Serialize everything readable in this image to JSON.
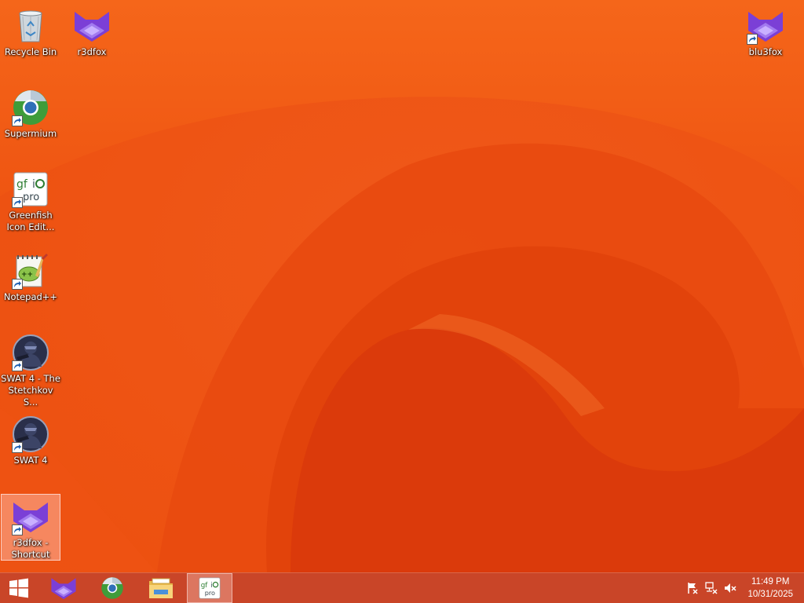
{
  "desktop": {
    "icons": [
      {
        "label": "Recycle Bin",
        "icon": "recycle-bin-icon"
      },
      {
        "label": "r3dfox",
        "icon": "r3dfox-icon"
      },
      {
        "label": "blu3fox",
        "icon": "blu3fox-icon"
      },
      {
        "label": "Supermium",
        "icon": "supermium-icon"
      },
      {
        "label": "Greenfish\nIcon Edit...",
        "icon": "greenfish-icon-editor-icon"
      },
      {
        "label": "Notepad++",
        "icon": "notepad-plus-plus-icon"
      },
      {
        "label": "SWAT 4 - The\nStetchkov S...",
        "icon": "swat4-stetchkov-icon"
      },
      {
        "label": "SWAT 4",
        "icon": "swat4-icon"
      },
      {
        "label": "r3dfox -\nShortcut",
        "icon": "r3dfox-shortcut-icon"
      }
    ]
  },
  "taskbar": {
    "start_icon": "windows-start-icon",
    "pinned": [
      {
        "icon": "r3dfox-icon"
      },
      {
        "icon": "supermium-icon"
      },
      {
        "icon": "file-explorer-icon"
      },
      {
        "icon": "greenfish-icon-editor-icon"
      }
    ],
    "tray": {
      "icons": [
        "action-center-flag-icon",
        "network-icon",
        "volume-muted-icon"
      ],
      "time": "11:49 PM",
      "date": "10/31/2025"
    }
  },
  "colors": {
    "wallpaper_base": "#f25a14",
    "taskbar": "#c94528",
    "fox_purple": "#7b3fd6"
  }
}
